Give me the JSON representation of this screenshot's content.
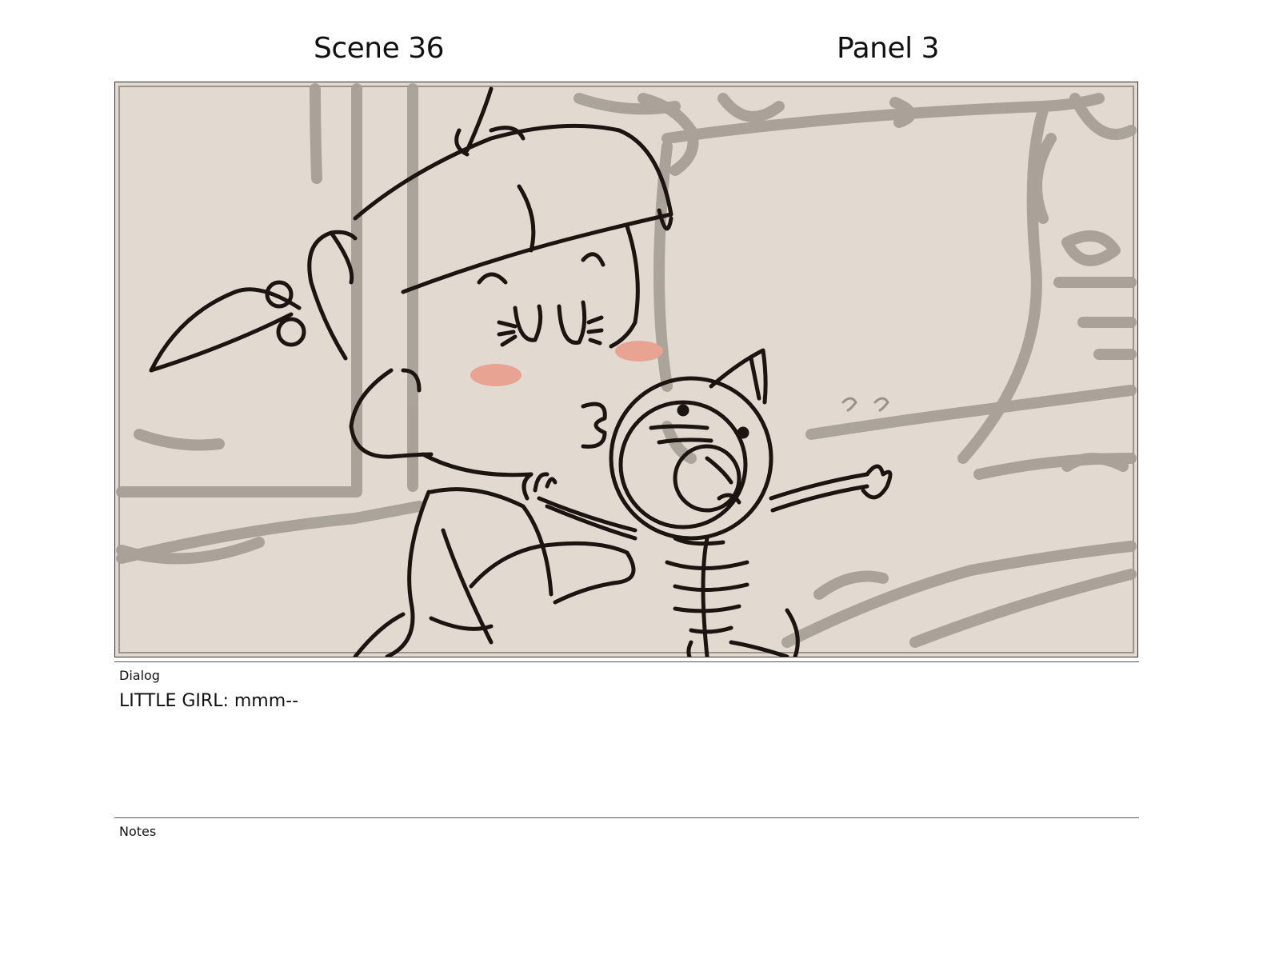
{
  "header": {
    "scene": "Scene 36",
    "panel": "Panel 3"
  },
  "panel_image": {
    "subject": "storyboard-drawing",
    "colors": {
      "background": "#e2dad0",
      "sketch": "#a59d94",
      "ink": "#1b1410",
      "blush": "#e8a392"
    }
  },
  "dialog": {
    "label": "Dialog",
    "text": "LITTLE GIRL: mmm--"
  },
  "notes": {
    "label": "Notes",
    "text": ""
  }
}
